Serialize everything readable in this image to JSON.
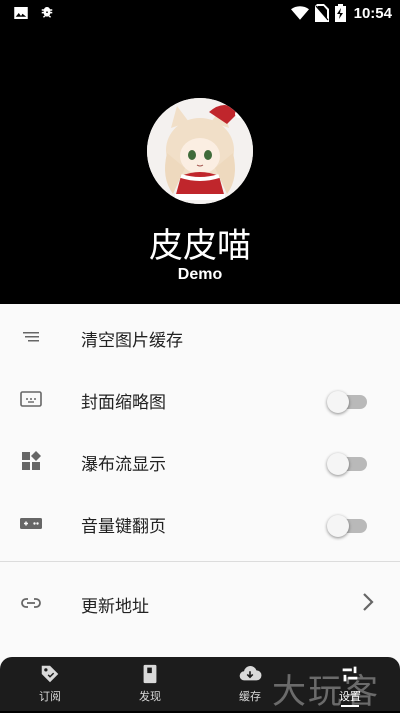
{
  "status_bar": {
    "time": "10:54",
    "icons": [
      "image-icon",
      "bug-icon",
      "wifi-icon",
      "no-sim-icon",
      "battery-charging-icon"
    ]
  },
  "profile": {
    "name": "皮皮喵",
    "subtitle": "Demo"
  },
  "settings": {
    "items": [
      {
        "label": "清空图片缓存",
        "icon": "sort-lines-icon",
        "type": "action"
      },
      {
        "label": "封面缩略图",
        "icon": "thumbnail-icon",
        "type": "toggle",
        "enabled": false
      },
      {
        "label": "瀑布流显示",
        "icon": "widgets-icon",
        "type": "toggle",
        "enabled": false
      },
      {
        "label": "音量键翻页",
        "icon": "gamepad-icon",
        "type": "toggle",
        "enabled": false
      },
      {
        "label": "更新地址",
        "icon": "link-icon",
        "type": "navigate"
      }
    ]
  },
  "bottom_nav": {
    "items": [
      {
        "label": "订阅",
        "icon": "tag-icon"
      },
      {
        "label": "发现",
        "icon": "book-icon"
      },
      {
        "label": "缓存",
        "icon": "cloud-download-icon"
      },
      {
        "label": "设置",
        "icon": "settings-icon",
        "active": true
      }
    ]
  },
  "watermark": "大玩客",
  "colors": {
    "header_bg": "#000000",
    "panel_bg": "#fafafa",
    "switch_track_off": "#b9b9b9",
    "nav_bg": "#1c1c1c"
  }
}
